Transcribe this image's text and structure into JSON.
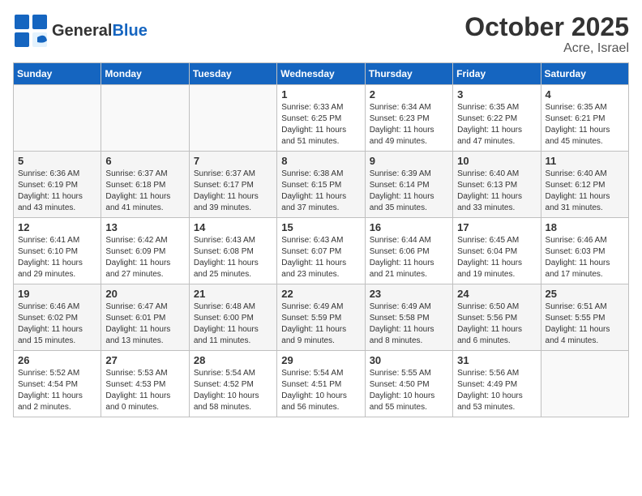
{
  "header": {
    "logo_general": "General",
    "logo_blue": "Blue",
    "month": "October 2025",
    "location": "Acre, Israel"
  },
  "days_of_week": [
    "Sunday",
    "Monday",
    "Tuesday",
    "Wednesday",
    "Thursday",
    "Friday",
    "Saturday"
  ],
  "weeks": [
    [
      {
        "day": "",
        "info": ""
      },
      {
        "day": "",
        "info": ""
      },
      {
        "day": "",
        "info": ""
      },
      {
        "day": "1",
        "info": "Sunrise: 6:33 AM\nSunset: 6:25 PM\nDaylight: 11 hours\nand 51 minutes."
      },
      {
        "day": "2",
        "info": "Sunrise: 6:34 AM\nSunset: 6:23 PM\nDaylight: 11 hours\nand 49 minutes."
      },
      {
        "day": "3",
        "info": "Sunrise: 6:35 AM\nSunset: 6:22 PM\nDaylight: 11 hours\nand 47 minutes."
      },
      {
        "day": "4",
        "info": "Sunrise: 6:35 AM\nSunset: 6:21 PM\nDaylight: 11 hours\nand 45 minutes."
      }
    ],
    [
      {
        "day": "5",
        "info": "Sunrise: 6:36 AM\nSunset: 6:19 PM\nDaylight: 11 hours\nand 43 minutes."
      },
      {
        "day": "6",
        "info": "Sunrise: 6:37 AM\nSunset: 6:18 PM\nDaylight: 11 hours\nand 41 minutes."
      },
      {
        "day": "7",
        "info": "Sunrise: 6:37 AM\nSunset: 6:17 PM\nDaylight: 11 hours\nand 39 minutes."
      },
      {
        "day": "8",
        "info": "Sunrise: 6:38 AM\nSunset: 6:15 PM\nDaylight: 11 hours\nand 37 minutes."
      },
      {
        "day": "9",
        "info": "Sunrise: 6:39 AM\nSunset: 6:14 PM\nDaylight: 11 hours\nand 35 minutes."
      },
      {
        "day": "10",
        "info": "Sunrise: 6:40 AM\nSunset: 6:13 PM\nDaylight: 11 hours\nand 33 minutes."
      },
      {
        "day": "11",
        "info": "Sunrise: 6:40 AM\nSunset: 6:12 PM\nDaylight: 11 hours\nand 31 minutes."
      }
    ],
    [
      {
        "day": "12",
        "info": "Sunrise: 6:41 AM\nSunset: 6:10 PM\nDaylight: 11 hours\nand 29 minutes."
      },
      {
        "day": "13",
        "info": "Sunrise: 6:42 AM\nSunset: 6:09 PM\nDaylight: 11 hours\nand 27 minutes."
      },
      {
        "day": "14",
        "info": "Sunrise: 6:43 AM\nSunset: 6:08 PM\nDaylight: 11 hours\nand 25 minutes."
      },
      {
        "day": "15",
        "info": "Sunrise: 6:43 AM\nSunset: 6:07 PM\nDaylight: 11 hours\nand 23 minutes."
      },
      {
        "day": "16",
        "info": "Sunrise: 6:44 AM\nSunset: 6:06 PM\nDaylight: 11 hours\nand 21 minutes."
      },
      {
        "day": "17",
        "info": "Sunrise: 6:45 AM\nSunset: 6:04 PM\nDaylight: 11 hours\nand 19 minutes."
      },
      {
        "day": "18",
        "info": "Sunrise: 6:46 AM\nSunset: 6:03 PM\nDaylight: 11 hours\nand 17 minutes."
      }
    ],
    [
      {
        "day": "19",
        "info": "Sunrise: 6:46 AM\nSunset: 6:02 PM\nDaylight: 11 hours\nand 15 minutes."
      },
      {
        "day": "20",
        "info": "Sunrise: 6:47 AM\nSunset: 6:01 PM\nDaylight: 11 hours\nand 13 minutes."
      },
      {
        "day": "21",
        "info": "Sunrise: 6:48 AM\nSunset: 6:00 PM\nDaylight: 11 hours\nand 11 minutes."
      },
      {
        "day": "22",
        "info": "Sunrise: 6:49 AM\nSunset: 5:59 PM\nDaylight: 11 hours\nand 9 minutes."
      },
      {
        "day": "23",
        "info": "Sunrise: 6:49 AM\nSunset: 5:58 PM\nDaylight: 11 hours\nand 8 minutes."
      },
      {
        "day": "24",
        "info": "Sunrise: 6:50 AM\nSunset: 5:56 PM\nDaylight: 11 hours\nand 6 minutes."
      },
      {
        "day": "25",
        "info": "Sunrise: 6:51 AM\nSunset: 5:55 PM\nDaylight: 11 hours\nand 4 minutes."
      }
    ],
    [
      {
        "day": "26",
        "info": "Sunrise: 5:52 AM\nSunset: 4:54 PM\nDaylight: 11 hours\nand 2 minutes."
      },
      {
        "day": "27",
        "info": "Sunrise: 5:53 AM\nSunset: 4:53 PM\nDaylight: 11 hours\nand 0 minutes."
      },
      {
        "day": "28",
        "info": "Sunrise: 5:54 AM\nSunset: 4:52 PM\nDaylight: 10 hours\nand 58 minutes."
      },
      {
        "day": "29",
        "info": "Sunrise: 5:54 AM\nSunset: 4:51 PM\nDaylight: 10 hours\nand 56 minutes."
      },
      {
        "day": "30",
        "info": "Sunrise: 5:55 AM\nSunset: 4:50 PM\nDaylight: 10 hours\nand 55 minutes."
      },
      {
        "day": "31",
        "info": "Sunrise: 5:56 AM\nSunset: 4:49 PM\nDaylight: 10 hours\nand 53 minutes."
      },
      {
        "day": "",
        "info": ""
      }
    ]
  ]
}
